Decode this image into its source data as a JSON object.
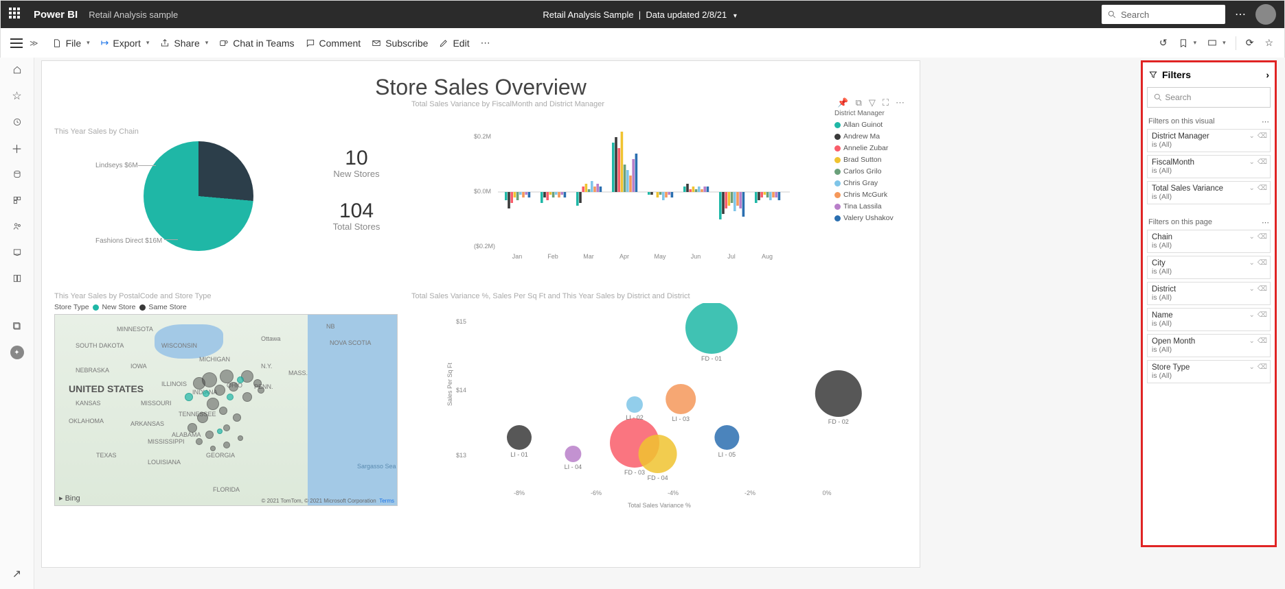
{
  "topbar": {
    "brand": "Power BI",
    "sample": "Retail Analysis sample",
    "center_title": "Retail Analysis Sample",
    "center_sub": "Data updated 2/8/21",
    "search_placeholder": "Search"
  },
  "toolbar": {
    "file": "File",
    "export": "Export",
    "share": "Share",
    "chat": "Chat in Teams",
    "comment": "Comment",
    "subscribe": "Subscribe",
    "edit": "Edit"
  },
  "report": {
    "title": "Store Sales Overview",
    "pie": {
      "title": "This Year Sales by Chain",
      "slices": [
        {
          "label": "Lindseys $6M",
          "value": 6,
          "color": "#2c3e4a"
        },
        {
          "label": "Fashions Direct $16M",
          "value": 16,
          "color": "#1fb7a6"
        }
      ]
    },
    "kpis": [
      {
        "value": "10",
        "label": "New Stores"
      },
      {
        "value": "104",
        "label": "Total Stores"
      }
    ],
    "bar_chart": {
      "title": "Total Sales Variance by FiscalMonth and District Manager",
      "legend_title": "District Manager",
      "y_ticks": [
        "$0.2M",
        "$0.0M",
        "($0.2M)"
      ],
      "managers": [
        {
          "name": "Allan Guinot",
          "color": "#1fb7a6"
        },
        {
          "name": "Andrew Ma",
          "color": "#3a3a3a"
        },
        {
          "name": "Annelie Zubar",
          "color": "#f95d6a"
        },
        {
          "name": "Brad Sutton",
          "color": "#f0c330"
        },
        {
          "name": "Carlos Grilo",
          "color": "#6aa07a"
        },
        {
          "name": "Chris Gray",
          "color": "#7fc5e8"
        },
        {
          "name": "Chris McGurk",
          "color": "#f5985a"
        },
        {
          "name": "Tina Lassila",
          "color": "#b87fc9"
        },
        {
          "name": "Valery Ushakov",
          "color": "#2b6fb0"
        }
      ],
      "months": [
        "Jan",
        "Feb",
        "Mar",
        "Apr",
        "May",
        "Jun",
        "Jul",
        "Aug"
      ]
    },
    "map": {
      "title": "This Year Sales by PostalCode and Store Type",
      "legend_label": "Store Type",
      "legend_items": [
        {
          "label": "New Store",
          "color": "#1fb7a6"
        },
        {
          "label": "Same Store",
          "color": "#3a3a3a"
        }
      ],
      "attribution": "© 2021 TomTom, © 2021 Microsoft Corporation",
      "terms": "Terms",
      "bing": "Bing"
    },
    "scatter": {
      "title": "Total Sales Variance %, Sales Per Sq Ft and This Year Sales by District and District",
      "xlabel": "Total Sales Variance %",
      "ylabel": "Sales Per Sq Ft",
      "x_ticks": [
        "-8%",
        "-6%",
        "-4%",
        "-2%",
        "0%"
      ],
      "y_ticks": [
        "$13",
        "$14",
        "$15"
      ],
      "points": [
        {
          "label": "FD - 01",
          "x": -3.0,
          "y": 15.3,
          "r": 38,
          "color": "#1fb7a6"
        },
        {
          "label": "FD - 02",
          "x": 0.3,
          "y": 14.1,
          "r": 34,
          "color": "#3a3a3a"
        },
        {
          "label": "FD - 03",
          "x": -5.0,
          "y": 13.2,
          "r": 36,
          "color": "#f95d6a"
        },
        {
          "label": "FD - 04",
          "x": -4.4,
          "y": 13.0,
          "r": 28,
          "color": "#f0c330"
        },
        {
          "label": "LI - 01",
          "x": -8.0,
          "y": 13.3,
          "r": 18,
          "color": "#3a3a3a"
        },
        {
          "label": "LI - 02",
          "x": -5.0,
          "y": 13.9,
          "r": 12,
          "color": "#7fc5e8"
        },
        {
          "label": "LI - 03",
          "x": -3.8,
          "y": 14.0,
          "r": 22,
          "color": "#f5985a"
        },
        {
          "label": "LI - 04",
          "x": -6.6,
          "y": 13.0,
          "r": 12,
          "color": "#b87fc9"
        },
        {
          "label": "LI - 05",
          "x": -2.6,
          "y": 13.3,
          "r": 18,
          "color": "#2b6fb0"
        }
      ]
    }
  },
  "filters": {
    "header": "Filters",
    "search_placeholder": "Search",
    "visual_title": "Filters on this visual",
    "page_title": "Filters on this page",
    "is_all": "is (All)",
    "visual_cards": [
      {
        "name": "District Manager"
      },
      {
        "name": "FiscalMonth"
      },
      {
        "name": "Total Sales Variance"
      }
    ],
    "page_cards": [
      {
        "name": "Chain"
      },
      {
        "name": "City"
      },
      {
        "name": "District"
      },
      {
        "name": "Name"
      },
      {
        "name": "Open Month"
      },
      {
        "name": "Store Type"
      }
    ]
  },
  "chart_data": {
    "pie": {
      "type": "pie",
      "title": "This Year Sales by Chain",
      "slices": [
        {
          "name": "Lindseys",
          "value": 6
        },
        {
          "name": "Fashions Direct",
          "value": 16
        }
      ],
      "unit": "$M"
    },
    "kpis": [
      {
        "label": "New Stores",
        "value": 10
      },
      {
        "label": "Total Stores",
        "value": 104
      }
    ],
    "bar": {
      "type": "bar",
      "title": "Total Sales Variance by FiscalMonth and District Manager",
      "ylabel": "Total Sales Variance",
      "ylim": [
        -0.2,
        0.2
      ],
      "unit": "$M",
      "categories": [
        "Jan",
        "Feb",
        "Mar",
        "Apr",
        "May",
        "Jun",
        "Jul",
        "Aug"
      ],
      "series": [
        {
          "name": "Allan Guinot",
          "values": [
            -0.03,
            -0.04,
            -0.05,
            0.18,
            -0.01,
            0.02,
            -0.1,
            -0.04
          ]
        },
        {
          "name": "Andrew Ma",
          "values": [
            -0.06,
            -0.02,
            -0.04,
            0.2,
            -0.01,
            0.03,
            -0.08,
            -0.03
          ]
        },
        {
          "name": "Annelie Zubar",
          "values": [
            -0.04,
            -0.03,
            0.02,
            0.16,
            0.0,
            0.01,
            -0.06,
            -0.02
          ]
        },
        {
          "name": "Brad Sutton",
          "values": [
            -0.02,
            -0.01,
            0.03,
            0.22,
            -0.02,
            0.02,
            -0.05,
            -0.01
          ]
        },
        {
          "name": "Carlos Grilo",
          "values": [
            -0.03,
            -0.02,
            0.01,
            0.1,
            -0.01,
            0.01,
            -0.04,
            -0.02
          ]
        },
        {
          "name": "Chris Gray",
          "values": [
            -0.01,
            -0.01,
            0.04,
            0.08,
            -0.03,
            0.02,
            -0.07,
            -0.03
          ]
        },
        {
          "name": "Chris McGurk",
          "values": [
            -0.02,
            -0.02,
            0.02,
            0.06,
            -0.02,
            0.01,
            -0.05,
            -0.02
          ]
        },
        {
          "name": "Tina Lassila",
          "values": [
            -0.01,
            -0.01,
            0.03,
            0.12,
            -0.01,
            0.02,
            -0.06,
            -0.02
          ]
        },
        {
          "name": "Valery Ushakov",
          "values": [
            -0.02,
            -0.02,
            0.02,
            0.14,
            -0.02,
            0.02,
            -0.09,
            -0.03
          ]
        }
      ]
    },
    "scatter": {
      "type": "scatter",
      "title": "Total Sales Variance %, Sales Per Sq Ft and This Year Sales by District and District",
      "xlabel": "Total Sales Variance %",
      "ylabel": "Sales Per Sq Ft",
      "xlim": [
        -9,
        1
      ],
      "ylim": [
        12.5,
        15.5
      ],
      "points": [
        {
          "label": "FD - 01",
          "x": -3.0,
          "y": 15.3,
          "size": 38
        },
        {
          "label": "FD - 02",
          "x": 0.3,
          "y": 14.1,
          "size": 34
        },
        {
          "label": "FD - 03",
          "x": -5.0,
          "y": 13.2,
          "size": 36
        },
        {
          "label": "FD - 04",
          "x": -4.4,
          "y": 13.0,
          "size": 28
        },
        {
          "label": "LI - 01",
          "x": -8.0,
          "y": 13.3,
          "size": 18
        },
        {
          "label": "LI - 02",
          "x": -5.0,
          "y": 13.9,
          "size": 12
        },
        {
          "label": "LI - 03",
          "x": -3.8,
          "y": 14.0,
          "size": 22
        },
        {
          "label": "LI - 04",
          "x": -6.6,
          "y": 13.0,
          "size": 12
        },
        {
          "label": "LI - 05",
          "x": -2.6,
          "y": 13.3,
          "size": 18
        }
      ]
    }
  }
}
